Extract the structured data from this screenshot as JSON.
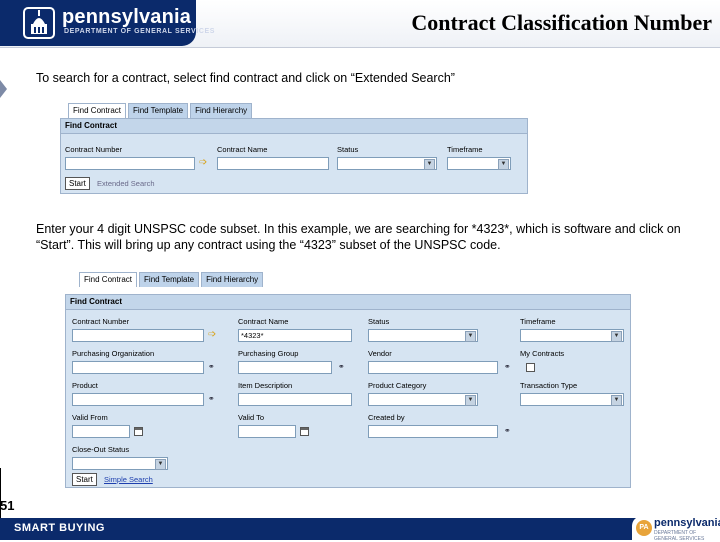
{
  "header": {
    "logo_text": "pennsylvania",
    "logo_sub": "DEPARTMENT OF GENERAL SERVICES",
    "title": "Contract Classification Number"
  },
  "instructions": {
    "step1": "To search for a contract, select find contract and click on “Extended Search”",
    "step2": "Enter your 4 digit UNSPSC code subset. In this example, we are searching for *4323*, which is software and click on “Start”.  This will bring up any contract using the “4323” subset of the UNSPSC code."
  },
  "screen1": {
    "tabs": [
      "Find Contract",
      "Find Template",
      "Find Hierarchy"
    ],
    "panel_title": "Find Contract",
    "fields": {
      "contract_number": "Contract Number",
      "contract_name": "Contract Name",
      "status": "Status",
      "timeframe": "Timeframe"
    },
    "start_button": "Start",
    "extended_search": "Extended Search"
  },
  "screen2": {
    "tabs": [
      "Find Contract",
      "Find Template",
      "Find Hierarchy"
    ],
    "panel_title": "Find Contract",
    "labels": {
      "contract_number": "Contract Number",
      "contract_name": "Contract Name",
      "status": "Status",
      "timeframe": "Timeframe",
      "purchasing_organization": "Purchasing Organization",
      "purchasing_group": "Purchasing Group",
      "vendor": "Vendor",
      "my_contracts": "My Contracts",
      "product": "Product",
      "item_description": "Item Description",
      "product_category": "Product Category",
      "transaction_type": "Transaction Type",
      "valid_from": "Valid From",
      "valid_to": "Valid To",
      "created_by": "Created by",
      "close_out_status": "Close-Out Status"
    },
    "contract_name_value": "*4323*",
    "start_button": "Start",
    "simple_search": "Simple Search"
  },
  "footer": {
    "label": "SMART BUYING",
    "logo_text": "pennsylvania",
    "logo_sub": "DEPARTMENT OF GENERAL SERVICES",
    "badge": "PA"
  },
  "page_number": "51"
}
